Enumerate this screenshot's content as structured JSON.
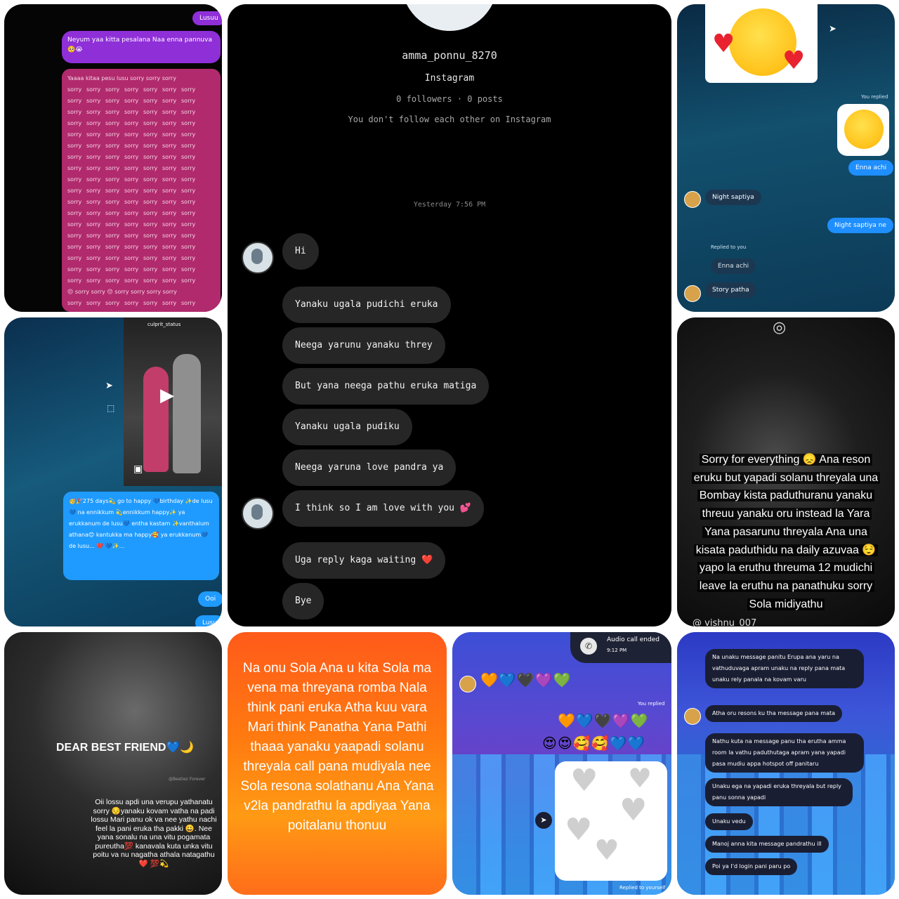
{
  "sorry_panel": {
    "top_pill": "Lusuu",
    "message": "Neyum yaa kitta pesalana Naa enna pannuva 🥺😭",
    "first_line": "Yaaaa kitaa pesu lusu sorry sorry sorry",
    "word": "sorry",
    "emoji_line": "😔 sorry sorry 😔 sorry sorry sorry sorry"
  },
  "center_chat": {
    "username": "amma_ponnu_8270",
    "platform": "Instagram",
    "stats": "0 followers · 0 posts",
    "follow_note": "You don't follow each other on Instagram",
    "timestamp": "Yesterday 7:56 PM",
    "messages": [
      "Hi",
      "Yanaku ugala pudichi eruka",
      "Neega yarunu yanaku threy",
      "But yana neega pathu eruka matiga",
      "Yanaku ugala pudiku",
      "Neega yaruna love pandra ya",
      "I think so I am love with you 💕",
      "Uga reply kaga waiting ❤️",
      "Bye"
    ]
  },
  "mermaid_panel": {
    "reel_user": "culprit_status",
    "message": "🥳🎉275 days💫 go to happy 💙birthday ✨de lusu💙 na ennikkum 💫ennikkum happy✨ ya erukkanum de lusu💙 entha kastam ✨vanthalum athana😊 kantukka ma happy🥰 ya erukkanum💙 de lusu... ❤️ 💙✨...",
    "pill_1": "Ooi",
    "pill_2": "Lusu"
  },
  "ocean_panel": {
    "you_replied": "You replied",
    "reply_1": "Enna achi",
    "night_in": "Night saptiya",
    "night_out": "Night saptiya ne",
    "replied_to_you": "Replied to you",
    "quoted": "Enna achi",
    "story": "Story patha"
  },
  "blur_panel": {
    "lines": [
      "Sorry for everything 😞 Ana reson",
      "eruku but yapadi solanu threyala una",
      "Bombay kista paduthuranu yanaku",
      "threuu  yanaku oru instead la Yara",
      "Yana pasarunu threyala Ana una",
      "kisata paduthidu na daily azuvaa 😌",
      "yapo la eruthu threuma 12 mudichi",
      "leave la eruthu na panathuku sorry",
      "Sola midiyathu"
    ],
    "handle": "@ vishnu_007"
  },
  "friend_panel": {
    "title": "DEAR BEST FRIEND💙🌙",
    "watermark": "@Bestiez Forever",
    "text": "Oii lossu apdi una verupu yathanatu sorry 😔yanaku kovam vatha na padi lossu Mari panu ok va nee yathu nachi feel la pani eruka tha pakki 😀. Nee yana sonalu na una vitu pogamata pureutha💯 kanavala kuta unka vitu poitu va nu nagatha athala natagathu ❤️ 💯💫"
  },
  "orange_panel": {
    "text": "Na onu Sola Ana u kita Sola ma vena ma threyana romba Nala think pani eruka Atha kuu vara Mari think Panatha Yana Pathi thaaa yanaku yaapadi solanu threyala call pana mudiyala nee Sola resona solathanu Ana Yana v2la pandrathu la apdiyaa Yana poitalanu thonuu"
  },
  "city_panel": {
    "call_status": "Audio call ended",
    "call_time": "9:12 PM",
    "row_1": "🧡💙🖤💜💚",
    "you_replied": "You replied",
    "row_2": "🧡💙🖤💜💚",
    "row_3": "😍😍🥰🥰💙💙",
    "footer": "Replied to yourself"
  },
  "city2_panel": {
    "messages": [
      "Na unaku message panitu Erupa ana yaru na vathuduvaga apram unaku na reply pana mata unaku rely panala na kovam varu",
      "Atha oru resons ku tha message pana mata",
      "Nathu kuta na message panu tha erutha amma room la vathu paduthutaga apram yana yapadi pasa mudiu appa hotspot off panitaru",
      "Unaku ega na yapadi eruka threyala but reply panu sonna yapadi",
      "Unaku vedu",
      "Manoj anna kita message pandrathu ill",
      "Poi ya I'd login pani paru po"
    ]
  }
}
